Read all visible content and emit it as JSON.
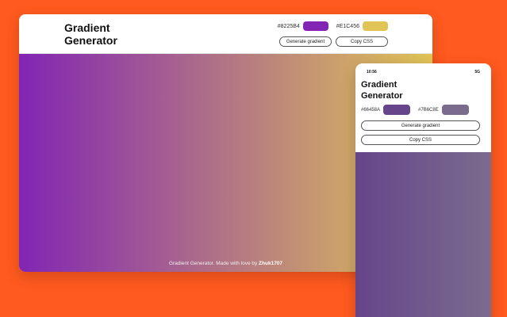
{
  "desktop": {
    "title": "Gradient Generator",
    "color1": {
      "hex": "#8225B4",
      "swatch": "#8225B4"
    },
    "color2": {
      "hex": "#E1C456",
      "swatch": "#E1C456"
    },
    "generate_label": "Generate gradient",
    "copy_label": "Copy CSS",
    "footer_text": "Gradient Generator. Made with love by",
    "footer_author": "Zhuk1707"
  },
  "mobile": {
    "time": "10:56",
    "status_right": "5G",
    "title": "Gradient Generator",
    "color1": {
      "hex": "#66458A",
      "swatch": "#66458A"
    },
    "color2": {
      "hex": "#7B6C8E",
      "swatch": "#7B6C8E"
    },
    "generate_label": "Generate gradient",
    "copy_label": "Copy CSS"
  },
  "colors": {
    "background": "#FF5A1F"
  }
}
